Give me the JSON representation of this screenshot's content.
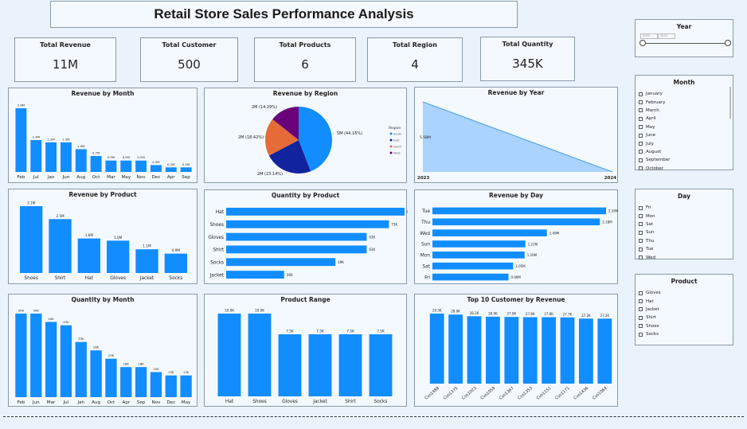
{
  "header": {
    "title": "Retail Store Sales Performance Analysis"
  },
  "kpis": [
    {
      "label": "Total Revenue",
      "value": "11M"
    },
    {
      "label": "Total Customer",
      "value": "500"
    },
    {
      "label": "Total Products",
      "value": "6"
    },
    {
      "label": "Total Region",
      "value": "4"
    },
    {
      "label": "Total Quantity",
      "value": "345K"
    }
  ],
  "slicers": {
    "year": {
      "title": "Year",
      "from": "2023",
      "to": "2024"
    },
    "month": {
      "title": "Month",
      "items": [
        "January",
        "February",
        "March",
        "April",
        "May",
        "June",
        "July",
        "August",
        "September",
        "October"
      ]
    },
    "day": {
      "title": "Day",
      "items": [
        "Fri",
        "Mon",
        "Sat",
        "Sun",
        "Thu",
        "Tue",
        "Wed"
      ]
    },
    "product": {
      "title": "Product",
      "items": [
        "Gloves",
        "Hat",
        "Jacket",
        "Shirt",
        "Shoes",
        "Socks"
      ]
    }
  },
  "colors": {
    "bar": "#118dff",
    "area": "#9dcdff",
    "areaLine": "#4a9ee8"
  },
  "chart_data": [
    {
      "id": "revenue-by-month",
      "type": "bar",
      "title": "Revenue by Month",
      "categories": [
        "Feb",
        "Jul",
        "Jan",
        "Jun",
        "Aug",
        "Oct",
        "Mar",
        "May",
        "Nov",
        "Dec",
        "Apr",
        "Sep"
      ],
      "values": [
        2.8,
        1.4,
        1.3,
        1.3,
        1.0,
        0.7,
        0.5,
        0.5,
        0.5,
        0.3,
        0.2,
        0.2
      ],
      "labels": [
        "2.8M",
        "1.4M",
        "1.3M",
        "1.3M",
        "1.0M",
        "0.7M",
        "0.5M",
        "0.5M",
        "0.5M",
        "0.3M",
        "0.2M",
        "0.2M"
      ]
    },
    {
      "id": "revenue-by-region",
      "type": "pie",
      "title": "Revenue by Region",
      "legend_title": "Region",
      "slices": [
        {
          "name": "South",
          "value": 44.16,
          "label": "5M (44.16%)",
          "color": "#118dff"
        },
        {
          "name": "East",
          "value": 23.14,
          "label": "2M (23.14%)",
          "color": "#12239e"
        },
        {
          "name": "North",
          "value": 18.42,
          "label": "2M (18.42%)",
          "color": "#e66c37"
        },
        {
          "name": "West",
          "value": 14.29,
          "label": "2M (14.29%)",
          "color": "#6b007b"
        }
      ]
    },
    {
      "id": "revenue-by-year",
      "type": "area",
      "title": "Revenue by Year",
      "categories": [
        "2023",
        "2024"
      ],
      "values": [
        5.58,
        0
      ],
      "labels": [
        "5.58M"
      ]
    },
    {
      "id": "revenue-by-product",
      "type": "bar",
      "title": "Revenue by Product",
      "categories": [
        "Shoes",
        "Shirt",
        "Hat",
        "Gloves",
        "Jacket",
        "Socks"
      ],
      "values": [
        3.1,
        2.5,
        1.6,
        1.5,
        1.1,
        0.9
      ],
      "labels": [
        "3.1M",
        "2.5M",
        "1.6M",
        "1.5M",
        "1.1M",
        "0.9M"
      ]
    },
    {
      "id": "quantity-by-product",
      "type": "hbar",
      "title": "Quantity by Product",
      "categories": [
        "Hat",
        "Shoes",
        "Gloves",
        "Shirt",
        "Socks",
        "Jacket"
      ],
      "values": [
        80,
        73,
        63,
        63,
        49,
        26
      ],
      "labels": [
        "80K",
        "73K",
        "63K",
        "63K",
        "49K",
        "26K"
      ]
    },
    {
      "id": "revenue-by-day",
      "type": "hbar",
      "title": "Revenue by Day",
      "categories": [
        "Tue",
        "Thu",
        "Wed",
        "Sun",
        "Mon",
        "Sat",
        "Fri"
      ],
      "values": [
        2.26,
        2.18,
        1.49,
        1.21,
        1.2,
        1.05,
        0.99
      ],
      "labels": [
        "2.26M",
        "2.18M",
        "1.49M",
        "1.21M",
        "1.20M",
        "1.05M",
        "0.99M"
      ]
    },
    {
      "id": "quantity-by-month",
      "type": "bar",
      "title": "Quantity by Month",
      "categories": [
        "Feb",
        "Jun",
        "Mar",
        "Jul",
        "Jan",
        "Aug",
        "Oct",
        "Apr",
        "Sep",
        "Nov",
        "Dec",
        "May"
      ],
      "values": [
        50,
        50,
        45,
        43,
        33,
        28,
        23,
        18,
        18,
        15,
        13,
        13
      ],
      "labels": [
        "50K",
        "50K",
        "45K",
        "43K",
        "33K",
        "28K",
        "23K",
        "18K",
        "18K",
        "15K",
        "13K",
        "13K"
      ]
    },
    {
      "id": "product-range",
      "type": "bar",
      "title": "Product Range",
      "categories": [
        "Hat",
        "Shoes",
        "Gloves",
        "Jacket",
        "Shirt",
        "Socks"
      ],
      "values": [
        10.0,
        10.0,
        7.5,
        7.5,
        7.5,
        7.5
      ],
      "labels": [
        "10.0K",
        "10.0K",
        "7.5K",
        "7.5K",
        "7.5K",
        "7.5K"
      ]
    },
    {
      "id": "top10-customer",
      "type": "bar",
      "title": "Top 10 Customer by Revenue",
      "categories": [
        "Cus1488",
        "Cus1375",
        "Cus1023",
        "Cus1059",
        "Cus1367",
        "Cus1353",
        "Cus1151",
        "Cus1171",
        "Cus1436",
        "Cus1064"
      ],
      "values": [
        29.3,
        28.9,
        28.2,
        28.0,
        27.9,
        27.8,
        27.8,
        27.7,
        27.2,
        27.2
      ],
      "labels": [
        "29.3K",
        "28.9K",
        "28.2K",
        "28.0K",
        "27.9K",
        "27.8K",
        "27.8K",
        "27.7K",
        "27.2K",
        "27.2K"
      ]
    }
  ]
}
